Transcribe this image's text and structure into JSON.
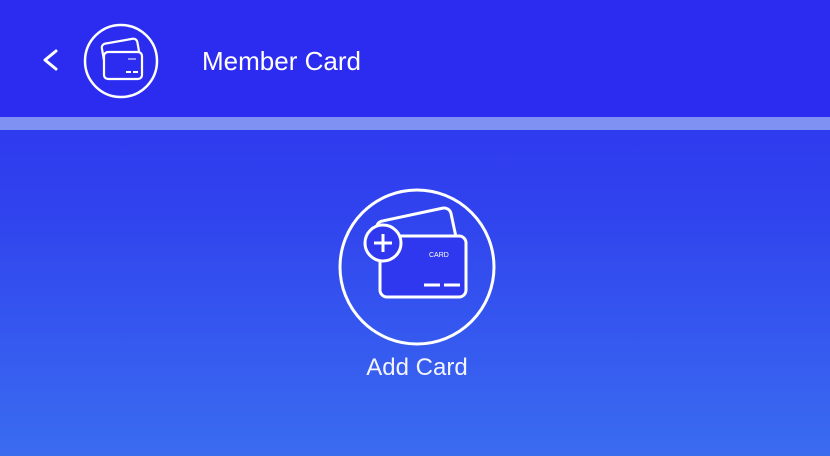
{
  "header": {
    "back_label": "<",
    "title": "Member Card",
    "icon": "member-card-icon"
  },
  "main": {
    "add_card_label": "Add Card",
    "add_card_icon": "add-card-icon",
    "card_text": "CARD"
  },
  "colors": {
    "header_bg": "#2c2cf0",
    "divider": "#7f92f4",
    "gradient_top": "#2d2ff0",
    "gradient_bottom": "#3a6cf0",
    "foreground": "#ffffff"
  }
}
